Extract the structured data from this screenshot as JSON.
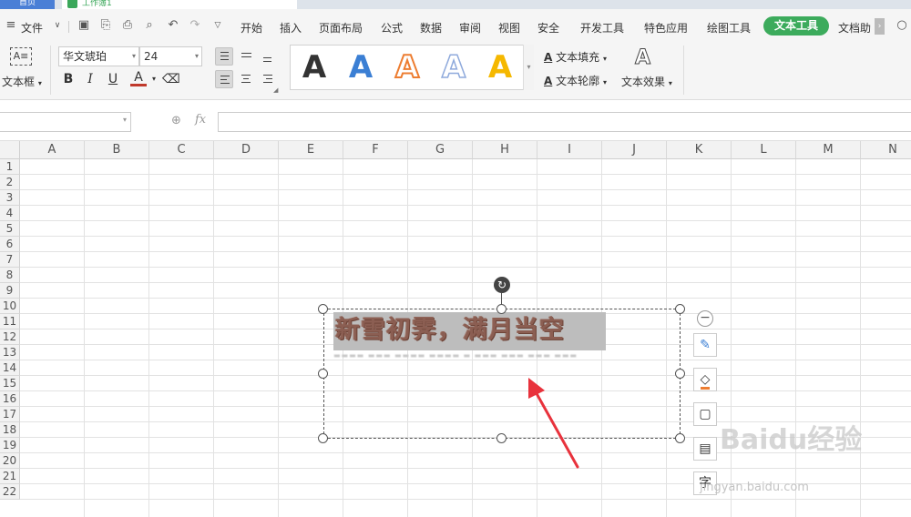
{
  "tabs": {
    "home": "首页",
    "doc": "工作簿1"
  },
  "menu": {
    "file": "文件",
    "items": [
      "开始",
      "插入",
      "页面布局",
      "公式",
      "数据",
      "审阅",
      "视图",
      "安全",
      "开发工具",
      "特色应用",
      "绘图工具"
    ],
    "active": "文本工具",
    "overflow": "文档助"
  },
  "ribbon": {
    "textbox_label": "文本框",
    "font_name": "华文琥珀",
    "font_size": "24",
    "bold": "B",
    "italic": "I",
    "underline": "U",
    "font_color": "A",
    "styles": [
      {
        "glyph": "A",
        "color": "#111111"
      },
      {
        "glyph": "A",
        "color": "#3b7fd4"
      },
      {
        "glyph": "A",
        "color": "#ed7d31"
      },
      {
        "glyph": "A",
        "color": "#8faadc"
      },
      {
        "glyph": "A",
        "color": "#f5b800"
      }
    ],
    "text_fill": "文本填充",
    "text_outline": "文本轮廓",
    "text_effect": "文本效果"
  },
  "formula": {
    "fx": "fx",
    "value": ""
  },
  "grid": {
    "columns": [
      "A",
      "B",
      "C",
      "D",
      "E",
      "F",
      "G",
      "H",
      "I",
      "J",
      "K",
      "L",
      "M",
      "N"
    ],
    "rows": [
      "1",
      "2",
      "3",
      "4",
      "5",
      "6",
      "7",
      "8",
      "9",
      "10",
      "11",
      "12",
      "13",
      "14",
      "15",
      "16",
      "17",
      "18",
      "19",
      "20",
      "21",
      "22"
    ]
  },
  "textbox": {
    "text": "新雪初霁，满月当空"
  },
  "side_tools": {
    "char_tool": "字"
  },
  "watermark": {
    "brand": "Baidu经验",
    "url": "jingyan.baidu.com"
  },
  "colors": {
    "active_tab": "#3cab5c",
    "arrow": "#e8323c",
    "headline_text": "#8b5e52"
  }
}
